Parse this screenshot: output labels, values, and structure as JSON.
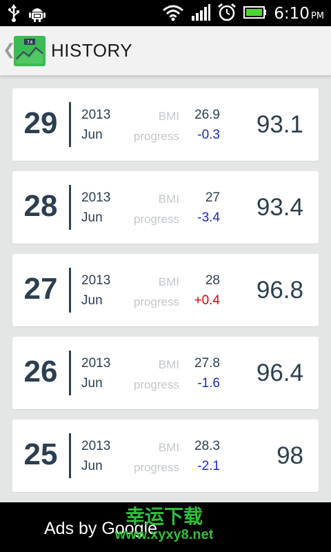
{
  "status_bar": {
    "time": "6:10",
    "ampm": "PM",
    "icons": [
      "usb-icon",
      "android-debug-icon",
      "wifi-icon",
      "signal-icon",
      "alarm-icon",
      "battery-icon"
    ]
  },
  "action_bar": {
    "title": "HISTORY",
    "logo_badge": "74",
    "back_icon": "chevron-left-icon"
  },
  "history": [
    {
      "day": "29",
      "year": "2013",
      "month": "Jun",
      "bmi_label": "BMI",
      "bmi": "26.9",
      "progress_label": "progress",
      "progress": "-0.3",
      "progress_color": "#1a28c8",
      "weight": "93.1"
    },
    {
      "day": "28",
      "year": "2013",
      "month": "Jun",
      "bmi_label": "BMI",
      "bmi": "27",
      "progress_label": "progress",
      "progress": "-3.4",
      "progress_color": "#1a28c8",
      "weight": "93.4"
    },
    {
      "day": "27",
      "year": "2013",
      "month": "Jun",
      "bmi_label": "BMI",
      "bmi": "28",
      "progress_label": "progress",
      "progress": "+0.4",
      "progress_color": "#e00000",
      "weight": "96.8"
    },
    {
      "day": "26",
      "year": "2013",
      "month": "Jun",
      "bmi_label": "BMI",
      "bmi": "27.8",
      "progress_label": "progress",
      "progress": "-1.6",
      "progress_color": "#1a28c8",
      "weight": "96.4"
    },
    {
      "day": "25",
      "year": "2013",
      "month": "Jun",
      "bmi_label": "BMI",
      "bmi": "28.3",
      "progress_label": "progress",
      "progress": "-2.1",
      "progress_color": "#1a28c8",
      "weight": "98"
    }
  ],
  "ad_bar": {
    "text": "Ads by Google",
    "watermark_cn": "幸运下载",
    "watermark_url": "www.xyxy8.net"
  },
  "colors": {
    "text_dark": "#2c3e50",
    "label_grey": "#c3c7ca",
    "negative_progress": "#1a28c8",
    "positive_progress": "#e00000",
    "background": "#e4e6e6",
    "logo_green": "#3cba54"
  }
}
